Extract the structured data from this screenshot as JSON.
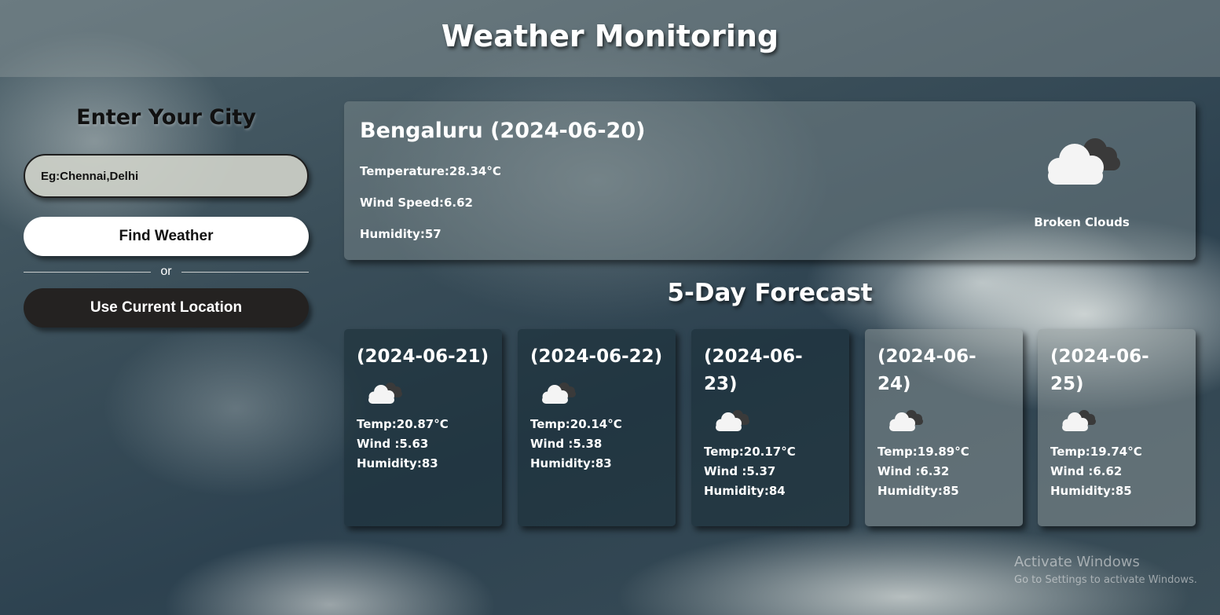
{
  "app": {
    "title": "Weather Monitoring"
  },
  "search": {
    "heading": "Enter Your City",
    "placeholder": "Eg:Chennai,Delhi",
    "find_label": "Find Weather",
    "or_label": "or",
    "location_label": "Use Current Location"
  },
  "current": {
    "title": "Bengaluru (2024-06-20)",
    "temperature": "Temperature:28.34°C",
    "wind": "Wind Speed:6.62",
    "humidity": "Humidity:57",
    "description": "Broken Clouds",
    "icon": "broken-clouds-icon"
  },
  "forecast": {
    "title": "5-Day Forecast",
    "days": [
      {
        "date": "(2024-06-21)",
        "temp": "Temp:20.87°C",
        "wind": "Wind :5.63",
        "humidity": "Humidity:83",
        "icon": "broken-clouds-icon"
      },
      {
        "date": "(2024-06-22)",
        "temp": "Temp:20.14°C",
        "wind": "Wind :5.38",
        "humidity": "Humidity:83",
        "icon": "broken-clouds-icon"
      },
      {
        "date": "(2024-06-23)",
        "temp": "Temp:20.17°C",
        "wind": "Wind :5.37",
        "humidity": "Humidity:84",
        "icon": "broken-clouds-icon"
      },
      {
        "date": "(2024-06-24)",
        "temp": "Temp:19.89°C",
        "wind": "Wind :6.32",
        "humidity": "Humidity:85",
        "icon": "broken-clouds-icon"
      },
      {
        "date": "(2024-06-25)",
        "temp": "Temp:19.74°C",
        "wind": "Wind :6.62",
        "humidity": "Humidity:85",
        "icon": "broken-clouds-icon"
      }
    ]
  },
  "watermark": {
    "line1": "Activate Windows",
    "line2": "Go to Settings to activate Windows."
  }
}
